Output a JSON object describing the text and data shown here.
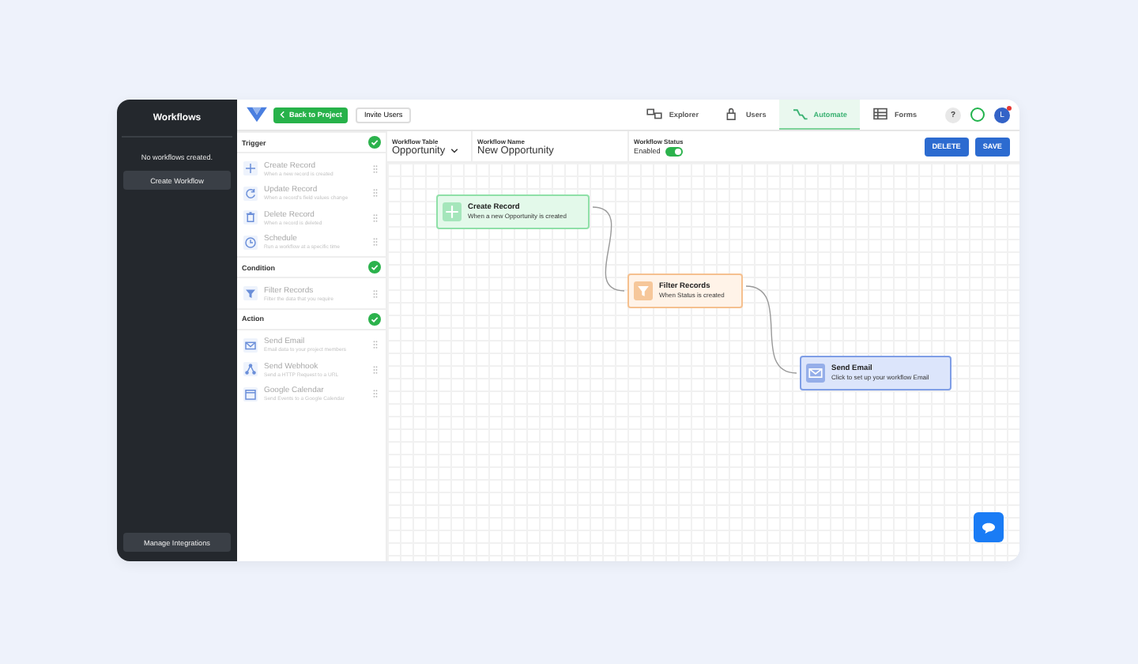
{
  "sidebar": {
    "title": "Workflows",
    "empty_text": "No workflows created.",
    "create_button": "Create Workflow",
    "footer_button": "Manage Integrations"
  },
  "toolbar": {
    "back_button": "Back to Project",
    "invite_button": "Invite Users",
    "help": "?",
    "avatar": "L",
    "tabs": [
      {
        "label": "Explorer",
        "selected": false
      },
      {
        "label": "Users",
        "selected": false
      },
      {
        "label": "Automate",
        "selected": true
      },
      {
        "label": "Forms",
        "selected": false
      }
    ]
  },
  "palette": [
    {
      "title": "Trigger",
      "completed": true,
      "items": [
        {
          "name": "Create Record",
          "description": "When a new record is created"
        },
        {
          "name": "Update Record",
          "description": "When a record's field values change"
        },
        {
          "name": "Delete Record",
          "description": "When a record is deleted"
        },
        {
          "name": "Schedule",
          "description": "Run a workflow at a specific time"
        }
      ]
    },
    {
      "title": "Condition",
      "completed": true,
      "items": [
        {
          "name": "Filter Records",
          "description": "Filter the data that you require"
        }
      ]
    },
    {
      "title": "Action",
      "completed": true,
      "items": [
        {
          "name": "Send Email",
          "description": "Email data to your project members"
        },
        {
          "name": "Send Webhook",
          "description": "Send a HTTP Request to a URL"
        },
        {
          "name": "Google Calendar",
          "description": "Send Events to a Google Calendar"
        }
      ]
    }
  ],
  "settings": {
    "workflow_table": {
      "label": "Workflow Table",
      "value": "Opportunity"
    },
    "workflow_name": {
      "label": "Workflow Name",
      "value": "New Opportunity"
    },
    "workflow_status": {
      "label": "Workflow Status",
      "value": "Enabled",
      "enabled": true
    },
    "buttons": [
      "DELETE",
      "SAVE"
    ]
  },
  "canvas": {
    "nodes": [
      {
        "kind": "trigger",
        "title": "Create Record",
        "subtitle": "When a new Opportunity is created"
      },
      {
        "kind": "condition",
        "title": "Filter Records",
        "subtitle": "When Status is created"
      },
      {
        "kind": "action",
        "title": "Send Email",
        "subtitle": "Click to set up your workflow Email"
      }
    ]
  }
}
